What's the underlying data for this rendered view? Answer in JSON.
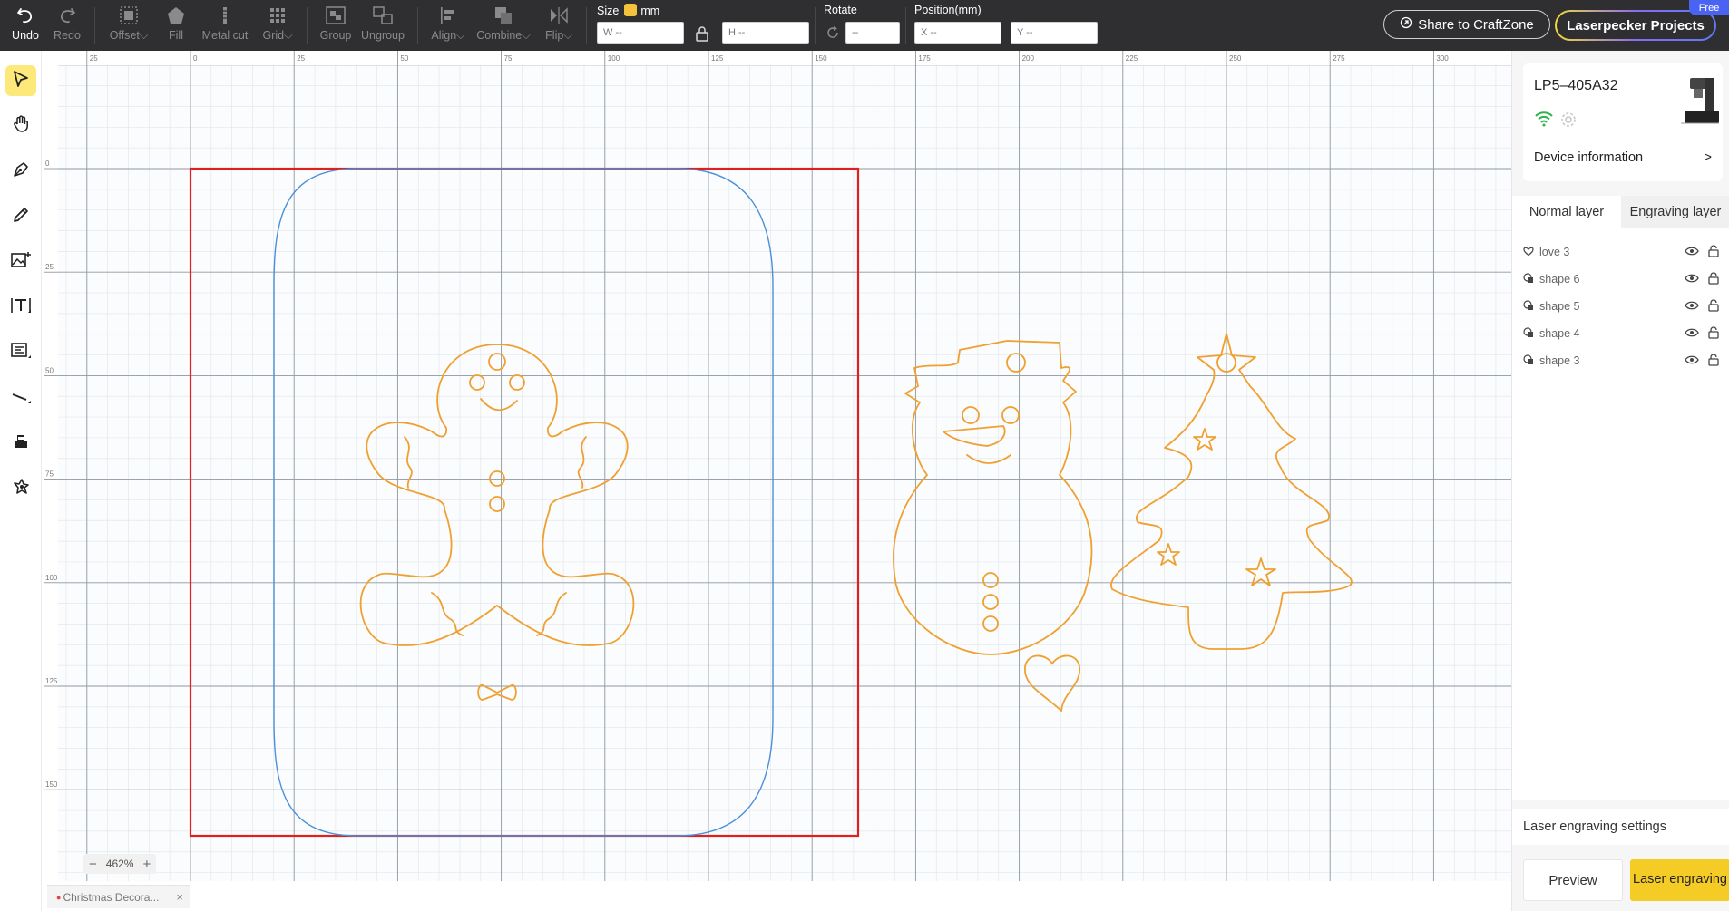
{
  "toolbar": {
    "undo": "Undo",
    "redo": "Redo",
    "offset": "Offset",
    "fill": "Fill",
    "metal_cut": "Metal cut",
    "grid": "Grid",
    "group": "Group",
    "ungroup": "Ungroup",
    "align": "Align",
    "combine": "Combine",
    "flip": "Flip",
    "size_label": "Size",
    "unit": "mm",
    "width_placeholder": "W --",
    "height_placeholder": "H --",
    "rotate_label": "Rotate",
    "rotate_placeholder": "--",
    "position_label": "Position(mm)",
    "x_placeholder": "X --",
    "y_placeholder": "Y --",
    "share": "Share to CraftZone",
    "projects": "Laserpecker Projects",
    "free_badge": "Free"
  },
  "left_tools": [
    "select-tool",
    "hand-tool",
    "pen-tool",
    "pencil-tool",
    "image-tool",
    "text-tool",
    "text-box-tool",
    "line-tool",
    "stamp-tool",
    "magic-tool"
  ],
  "rulers": {
    "horizontal": [
      "25",
      "0",
      "25",
      "50",
      "75",
      "100",
      "125",
      "150",
      "175",
      "200",
      "225",
      "250",
      "275",
      "300"
    ],
    "vertical": [
      "0",
      "25",
      "50",
      "75",
      "100",
      "125",
      "150"
    ]
  },
  "zoom": {
    "value": "462%",
    "minus": "−",
    "plus": "+"
  },
  "doc_tab": {
    "title": "Christmas Decora...",
    "close": "×"
  },
  "device": {
    "name": "LP5–405A32",
    "info": "Device information",
    "info_arrow": ">"
  },
  "layer_tabs": {
    "normal": "Normal layer",
    "engraving": "Engraving layer"
  },
  "layers": [
    {
      "name": "love 3",
      "icon": "heart-icon"
    },
    {
      "name": "shape 6",
      "icon": "shape-icon"
    },
    {
      "name": "shape 5",
      "icon": "shape-icon"
    },
    {
      "name": "shape 4",
      "icon": "shape-icon"
    },
    {
      "name": "shape 3",
      "icon": "shape-icon"
    }
  ],
  "laser_settings": "Laser engraving settings",
  "buttons": {
    "preview": "Preview",
    "laser": "Laser engraving"
  },
  "colors": {
    "toolbar_bg": "#2f2f31",
    "accent_yellow": "#f5cb25",
    "artboard_red": "#e02020",
    "outline_blue": "#4a90d9",
    "shape_orange": "#f0a030"
  }
}
